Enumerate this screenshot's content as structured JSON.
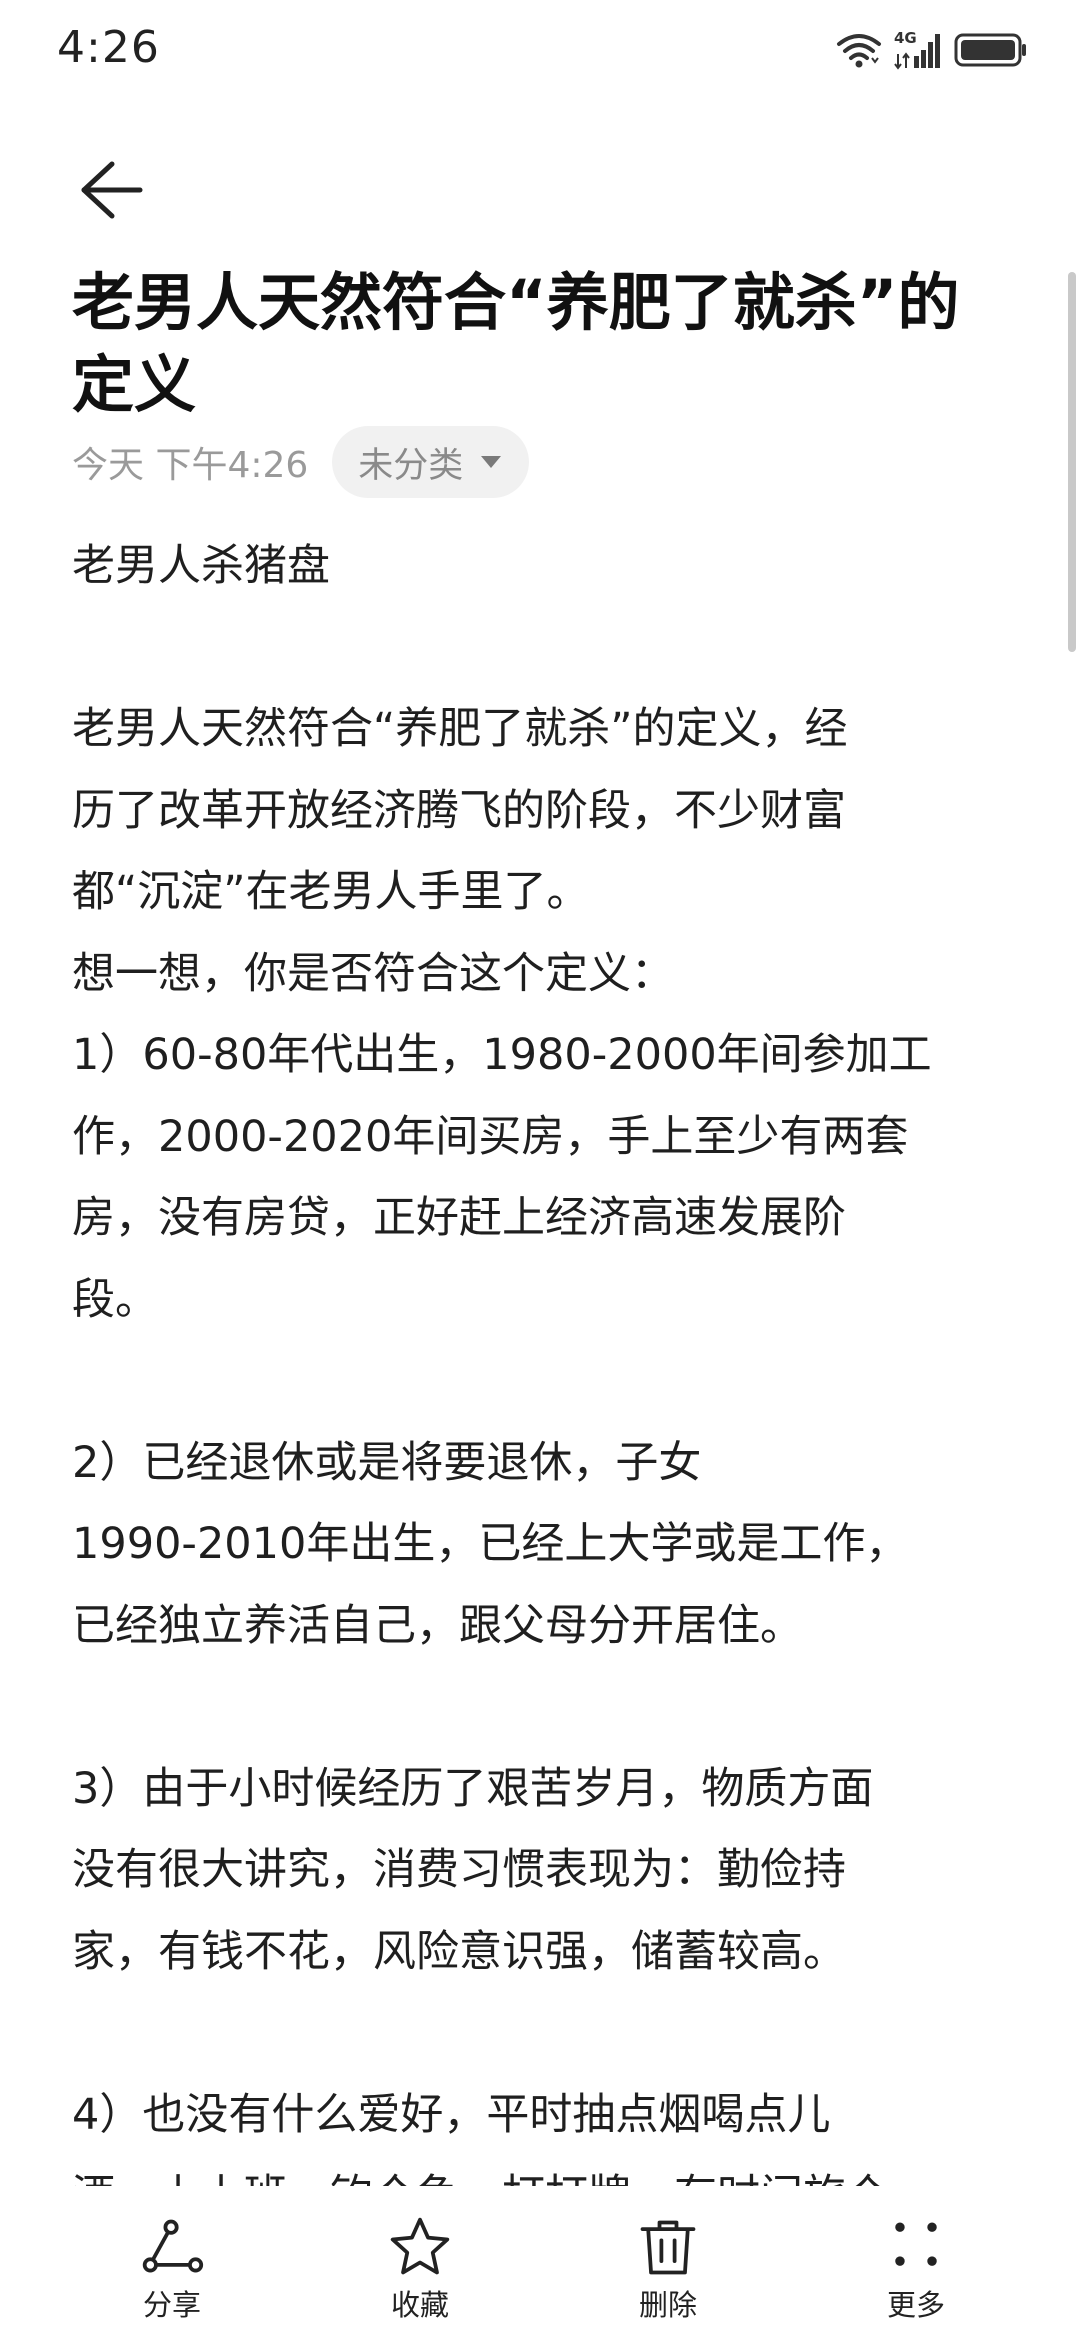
{
  "status_bar": {
    "time": "4:26",
    "network_label": "4G"
  },
  "note": {
    "title": "老男人天然符合“养肥了就杀”的定义",
    "date": "今天 下午4:26",
    "category": "未分类",
    "body_lines": [
      "老男人杀猪盘",
      "",
      "老男人天然符合“养肥了就杀”的定义，经",
      "历了改革开放经济腾飞的阶段，不少财富",
      "都“沉淀”在老男人手里了。",
      "想一想，你是否符合这个定义：",
      "1）60-80年代出生，1980-2000年间参加工",
      "作，2000-2020年间买房，手上至少有两套",
      "房，没有房贷，正好赶上经济高速发展阶",
      "段。",
      "",
      "2）已经退休或是将要退休，子女",
      "1990-2010年出生，已经上大学或是工作，",
      "已经独立养活自己，跟父母分开居住。",
      "",
      "3）由于小时候经历了艰苦岁月，物质方面",
      "没有很大讲究，消费习惯表现为：勤俭持",
      "家，有钱不花，风险意识强，储蓄较高。",
      "",
      "4）也没有什么爱好，平时抽点烟喝点儿",
      "酒，上上班，钓个鱼，打打牌，有时间旅个"
    ]
  },
  "toolbar": {
    "share_label": "分享",
    "favorite_label": "收藏",
    "delete_label": "删除",
    "more_label": "更多"
  }
}
